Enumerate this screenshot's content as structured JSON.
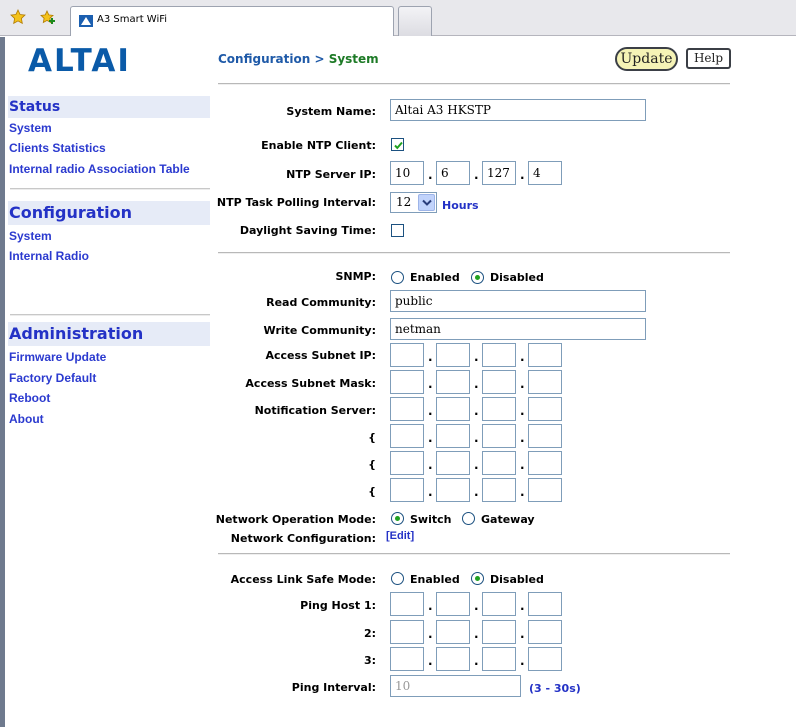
{
  "browser": {
    "tab_title": "A3 Smart WiFi"
  },
  "brand": {
    "logo_text": "ALTAI",
    "logo_color": "#0a5aa8"
  },
  "sidebar": {
    "status": {
      "heading": "Status",
      "items": [
        "System",
        "Clients Statistics",
        "Internal radio Association Table"
      ]
    },
    "configuration": {
      "heading": "Configuration",
      "items": [
        "System",
        "Internal Radio"
      ]
    },
    "administration": {
      "heading": "Administration",
      "items": [
        "Firmware Update",
        "Factory Default",
        "Reboot",
        "About"
      ]
    }
  },
  "header": {
    "breadcrumb_parent": "Configuration",
    "breadcrumb_separator": " > ",
    "breadcrumb_current": "System",
    "update_label": "Update",
    "help_label": "Help"
  },
  "system": {
    "name_label": "System Name:",
    "name_value": "Altai A3 HKSTP",
    "ntp_enable_label": "Enable NTP Client:",
    "ntp_enabled": true,
    "ntp_server_label": "NTP Server IP:",
    "ntp_server_ip": [
      "10",
      "6",
      "127",
      "4"
    ],
    "polling_label": "NTP Task Polling Interval:",
    "polling_value": "12",
    "polling_unit": "Hours",
    "dst_label": "Daylight Saving Time:",
    "dst_enabled": false
  },
  "snmp": {
    "label": "SNMP:",
    "enabled_label": "Enabled",
    "disabled_label": "Disabled",
    "selected": "Disabled",
    "read_label": "Read Community:",
    "read_value": "public",
    "write_label": "Write Community:",
    "write_value": "netman",
    "subnet_ip_label": "Access Subnet IP:",
    "subnet_mask_label": "Access Subnet Mask:",
    "notification_label": "Notification Server:",
    "extra_row_label": "{"
  },
  "network": {
    "mode_label": "Network Operation Mode:",
    "switch_label": "Switch",
    "gateway_label": "Gateway",
    "selected": "Switch",
    "config_label": "Network Configuration:",
    "edit_link": "[Edit]"
  },
  "safe_mode": {
    "label": "Access Link Safe Mode:",
    "enabled_label": "Enabled",
    "disabled_label": "Disabled",
    "selected": "Disabled",
    "ping1_label": "Ping Host 1:",
    "ping2_label": "2:",
    "ping3_label": "3:",
    "interval_label": "Ping Interval:",
    "interval_value": "10",
    "interval_range": "(3 - 30s)"
  },
  "colors": {
    "link_blue": "#2432c6",
    "sidebar_bg": "#e6ebf7",
    "radio_dot": "#21a121"
  }
}
